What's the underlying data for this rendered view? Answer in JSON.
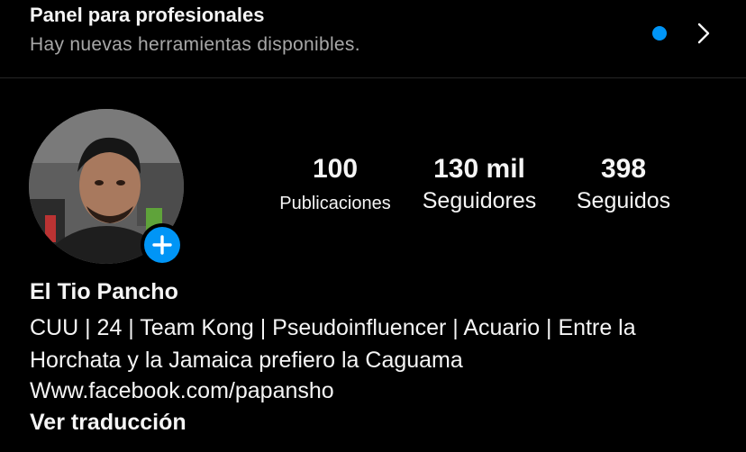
{
  "banner": {
    "title": "Panel para profesionales",
    "subtitle": "Hay nuevas herramientas disponibles.",
    "dot_color": "#0095f6",
    "chevron_icon": "chevron-right-icon"
  },
  "profile": {
    "avatar_icon": "profile-photo",
    "add_icon": "plus-icon",
    "name": "El Tio Pancho",
    "bio": "CUU | 24 | Team Kong | Pseudoinfluencer | Acuario | Entre la Horchata y la Jamaica prefiero la Caguama",
    "link": "Www.facebook.com/papansho",
    "translate": "Ver traducción"
  },
  "stats": {
    "posts": {
      "value": "100",
      "label": "Publicaciones"
    },
    "followers": {
      "value": "130 mil",
      "label": "Seguidores"
    },
    "following": {
      "value": "398",
      "label": "Seguidos"
    }
  }
}
